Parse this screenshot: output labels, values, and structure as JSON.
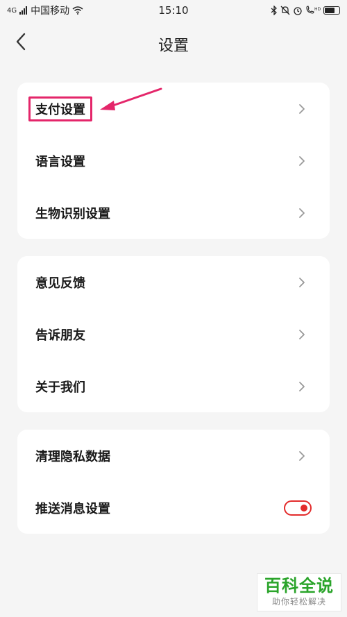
{
  "status_bar": {
    "signal_label": "4G",
    "carrier": "中国移动",
    "time": "15:10",
    "icons": [
      "wifi-icon",
      "bluetooth-icon",
      "mute-icon",
      "alarm-icon",
      "hd-call-icon",
      "battery-icon"
    ]
  },
  "header": {
    "title": "设置",
    "back_icon": "chevron-left-icon"
  },
  "groups": [
    {
      "items": [
        {
          "label": "支付设置",
          "icon": "chevron-right-icon",
          "highlighted": true
        },
        {
          "label": "语言设置",
          "icon": "chevron-right-icon"
        },
        {
          "label": "生物识别设置",
          "icon": "chevron-right-icon"
        }
      ]
    },
    {
      "items": [
        {
          "label": "意见反馈",
          "icon": "chevron-right-icon"
        },
        {
          "label": "告诉朋友",
          "icon": "chevron-right-icon"
        },
        {
          "label": "关于我们",
          "icon": "chevron-right-icon"
        }
      ]
    },
    {
      "items": [
        {
          "label": "清理隐私数据",
          "icon": "chevron-right-icon"
        },
        {
          "label": "推送消息设置",
          "toggle_on": true
        }
      ]
    }
  ],
  "annotation_color": "#e4266a",
  "toggle_color": "#e32b2b",
  "watermark": {
    "title": "百科全说",
    "subtitle": "助你轻松解决"
  }
}
